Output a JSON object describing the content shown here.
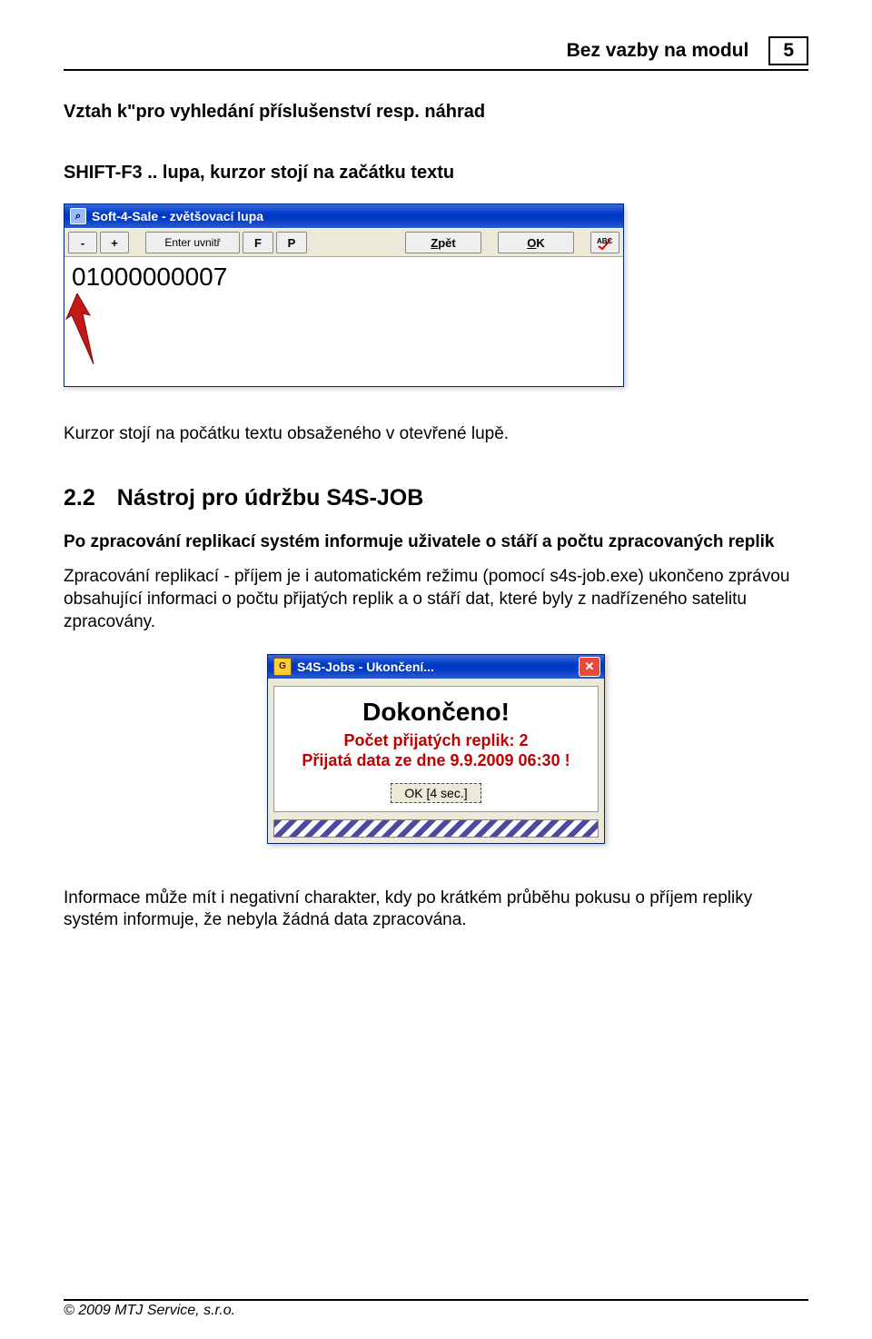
{
  "header": {
    "title": "Bez vazby na modul",
    "page_number": "5"
  },
  "line1": "Vztah k\"pro vyhledání příslušenství resp. náhrad",
  "shortcut_line": "SHIFT-F3 .. lupa, kurzor stojí na začátku textu",
  "win1": {
    "title": "Soft-4-Sale - zvětšovací lupa",
    "icon_glyph": "⌕",
    "btn_minus": "-",
    "btn_plus": "+",
    "btn_enter": "Enter uvnitř",
    "btn_f": "F",
    "btn_p": "P",
    "btn_back": "Zpět",
    "btn_ok": "OK",
    "btn_spell_glyph": "✓",
    "content_value": "01000000007"
  },
  "para1": "Kurzor stojí na počátku textu obsaženého v otevřené lupě.",
  "section": {
    "num": "2.2",
    "title": "Nástroj pro údržbu S4S-JOB",
    "lead": "Po zpracování replikací systém informuje uživatele o stáří a počtu zpracovaných replik",
    "body": "Zpracování replikací - příjem je i automatickém režimu (pomocí s4s-job.exe) ukončeno zprávou obsahující informaci o počtu přijatých replik a o stáří dat, které byly z nadřízeného satelitu zpracovány."
  },
  "win2": {
    "title": "S4S-Jobs - Ukončení...",
    "icon_glyph": "G",
    "close_glyph": "✕",
    "done": "Dokončeno!",
    "line1": "Počet přijatých replik: 2",
    "line2": "Přijatá data ze dne 9.9.2009 06:30 !",
    "ok": "OK [4 sec.]"
  },
  "para_final": "Informace může mít i negativní charakter, kdy po krátkém průběhu pokusu o příjem repliky systém informuje, že nebyla žádná data zpracována.",
  "footer": "© 2009 MTJ Service, s.r.o."
}
